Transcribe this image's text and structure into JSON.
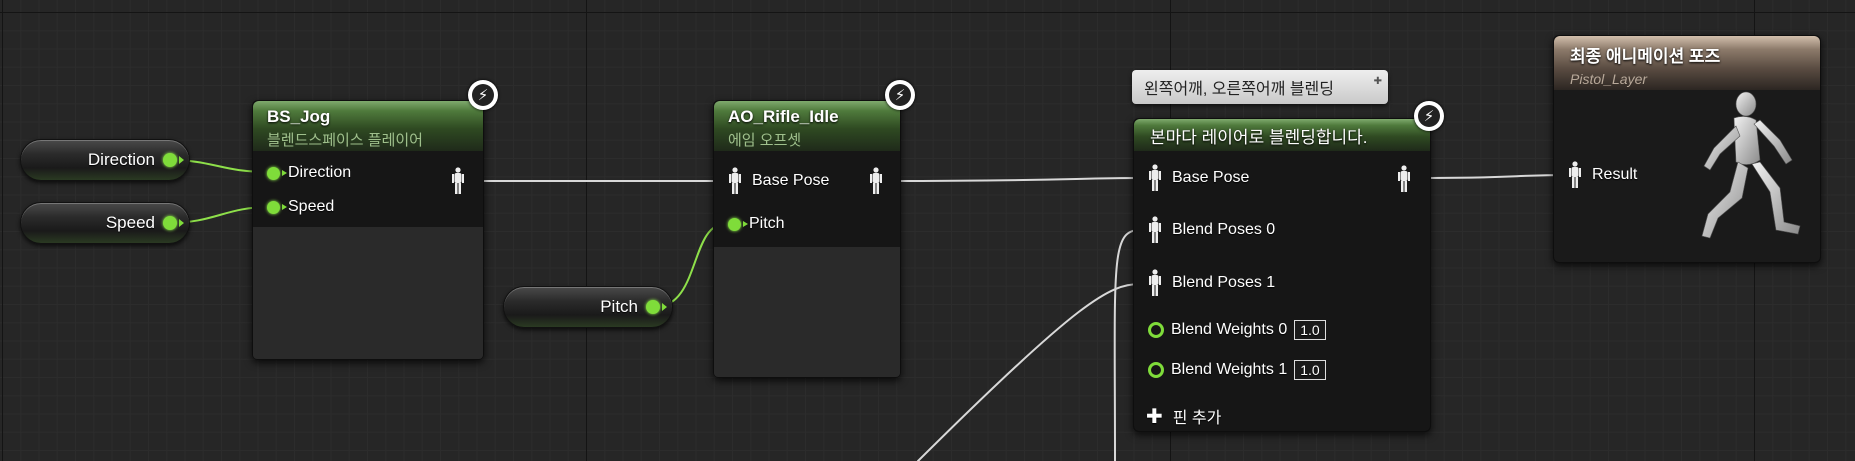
{
  "variables": {
    "direction": "Direction",
    "speed": "Speed",
    "pitch": "Pitch"
  },
  "bs_jog": {
    "title": "BS_Jog",
    "subtitle": "블렌드스페이스 플레이어",
    "pins": [
      "Direction",
      "Speed"
    ]
  },
  "ao_rifle": {
    "title": "AO_Rifle_Idle",
    "subtitle": "에임 오프셋",
    "pins": [
      "Base Pose",
      "Pitch"
    ]
  },
  "layered_blend": {
    "comment": "왼쪽어깨, 오른쪽어깨 블렌딩",
    "title": "본마다 레이어로 블렌딩합니다.",
    "pins": [
      "Base Pose",
      "Blend Poses 0",
      "Blend Poses 1",
      "Blend Weights 0",
      "Blend Weights 1"
    ],
    "weight0": "1.0",
    "weight1": "1.0",
    "add_pin": "핀 추가"
  },
  "final_pose": {
    "title": "최종 애니메이션 포즈",
    "subtitle": "Pistol_Layer",
    "result": "Result"
  },
  "colors": {
    "exec_pin": "#7fdc3a",
    "wire_green": "#8ee04a",
    "wire_white": "#d8d8d8"
  }
}
